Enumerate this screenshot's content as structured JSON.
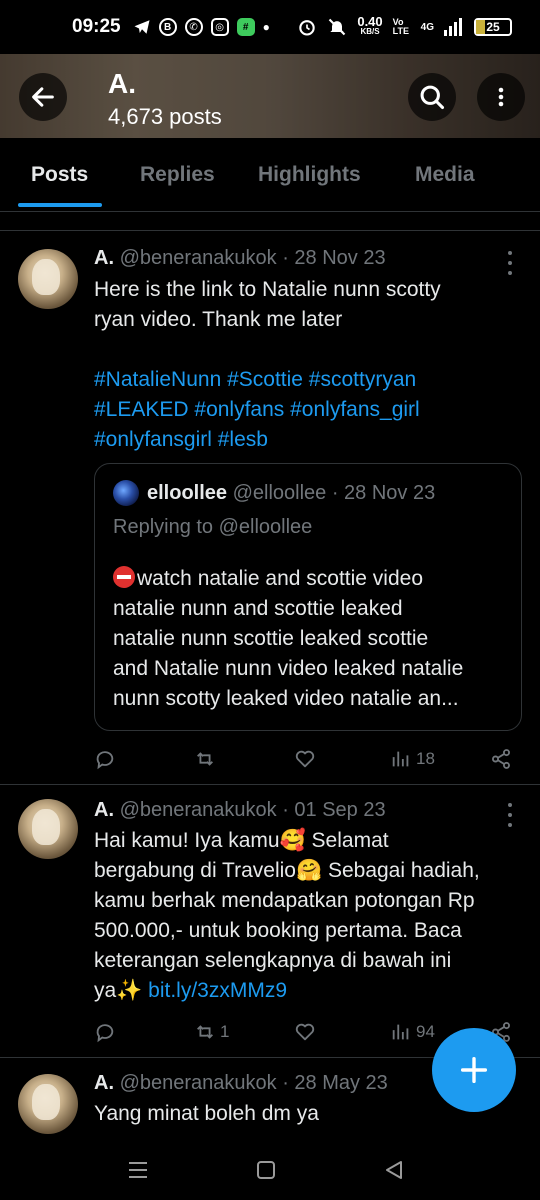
{
  "status_bar": {
    "time": "09:25",
    "net_speed_value": "0.40",
    "net_speed_unit": "KB/S",
    "volte": "Vo LTE",
    "network": "4G",
    "battery": "25",
    "battery_level": 0.25,
    "icons": [
      "telegram-icon",
      "b-badge-icon",
      "whatsapp-icon",
      "instagram-icon",
      "app-badge-icon",
      "dot-icon",
      "alarm-icon",
      "mute-icon",
      "signal-icon",
      "battery-icon"
    ]
  },
  "header": {
    "name": "A.",
    "posts_count": "4,673 posts"
  },
  "tabs": [
    {
      "label": "Posts",
      "active": true
    },
    {
      "label": "Replies",
      "active": false
    },
    {
      "label": "Highlights",
      "active": false
    },
    {
      "label": "Media",
      "active": false
    }
  ],
  "posts": [
    {
      "name": "A.",
      "handle": "@beneranakukok · 28 Nov 23",
      "text_lines": [
        "Here is the link to Natalie nunn scotty",
        "ryan video.  Thank me later"
      ],
      "hashtag_lines": [
        "#NatalieNunn #Scottie #scottyryan",
        "#LEAKED #onlyfans #onlyfans_girl",
        "#onlyfansgirl #lesb"
      ],
      "quote": {
        "name": "elloollee",
        "handle": "@elloollee · 28 Nov 23",
        "replying": "Replying to @elloollee",
        "text_lines": [
          "watch natalie and scottie video",
          "natalie nunn and scottie leaked",
          "natalie nunn scottie leaked scottie",
          "and Natalie nunn video leaked natalie",
          "nunn scotty leaked video natalie an..."
        ]
      },
      "replies": "",
      "reposts": "",
      "likes": "",
      "views": "18"
    },
    {
      "name": "A.",
      "handle": "@beneranakukok · 01 Sep 23",
      "text_lines": [
        "Hai kamu! Iya kamu🥰 Selamat",
        "bergabung di Travelio🤗 Sebagai hadiah,",
        "kamu berhak mendapatkan potongan Rp",
        "500.000,- untuk booking pertama. Baca",
        "keterangan selengkapnya di bawah ini"
      ],
      "last_line_prefix": "ya✨ ",
      "link": "bit.ly/3zxMMz9",
      "replies": "",
      "reposts": "1",
      "likes": "",
      "views": "94"
    },
    {
      "name": "A.",
      "handle": "@beneranakukok · 28 May 23",
      "text_lines": [
        "Yang minat boleh dm ya"
      ]
    }
  ],
  "fab": {
    "icon": "plus-icon"
  },
  "navbar": {
    "icons": [
      "recent-apps-icon",
      "home-icon",
      "back-icon"
    ]
  },
  "colors": {
    "accent": "#1d9bf0",
    "background": "#000000",
    "text": "#e7e9ea",
    "muted": "#71767b",
    "border": "#2f3336"
  }
}
